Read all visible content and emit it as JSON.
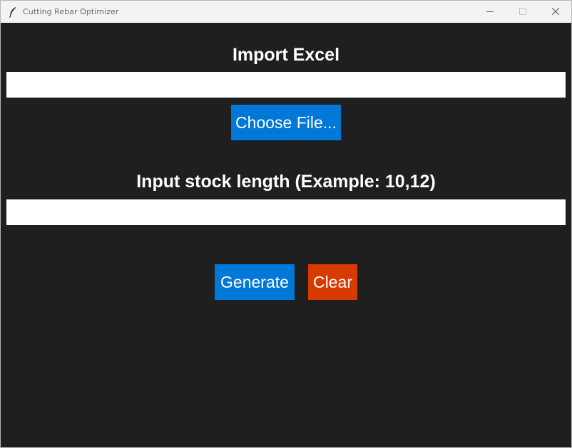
{
  "window": {
    "title": "Cutting Rebar Optimizer",
    "icon": "feather-icon",
    "controls": [
      "minimize-icon",
      "maximize-icon",
      "close-icon"
    ]
  },
  "import_section": {
    "heading": "Import Excel",
    "file_path_value": "",
    "choose_button_label": "Choose File..."
  },
  "stock_section": {
    "heading": "Input stock length (Example: 10,12)",
    "stock_length_value": ""
  },
  "actions": {
    "generate_label": "Generate",
    "clear_label": "Clear"
  },
  "colors": {
    "background": "#1f1f1f",
    "primary_button": "#0078d7",
    "danger_button": "#d83b01",
    "titlebar": "#f3f3f3"
  }
}
